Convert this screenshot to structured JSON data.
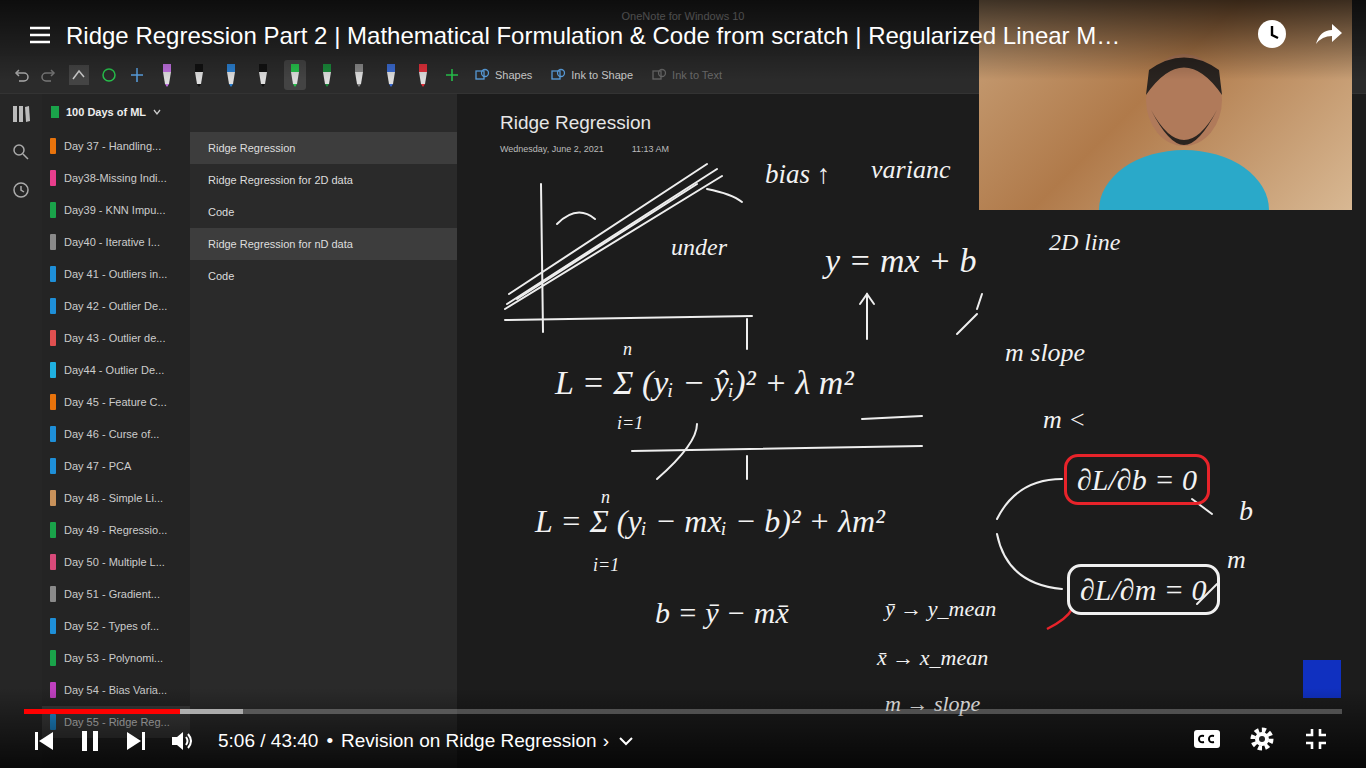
{
  "player": {
    "title": "Ridge Regression Part 2 | Mathematical Formulation & Code from scratch | Regularized Linear M…",
    "time": "5:06 / 43:40",
    "separator": "•",
    "chapter": "Revision on Ridge Regression",
    "chapter_arrow": "›",
    "playing": true,
    "level": 0.118,
    "buffered": 0.166
  },
  "onenote": {
    "app_title": "OneNote for Windows 10",
    "pens": [
      {
        "color": "#c070e0",
        "selected": false
      },
      {
        "color": "#111111",
        "selected": false
      },
      {
        "color": "#2a7fd0",
        "selected": false
      },
      {
        "color": "#111111",
        "selected": false
      },
      {
        "color": "#27c24c",
        "selected": true
      },
      {
        "color": "#1a8a3a",
        "selected": false
      },
      {
        "color": "#888888",
        "selected": false
      },
      {
        "color": "#3a6ad0",
        "selected": false
      },
      {
        "color": "#e0303a",
        "selected": false
      }
    ],
    "toolbar": [
      {
        "label": "Shapes",
        "disabled": false
      },
      {
        "label": "Ink to Shape",
        "disabled": false
      },
      {
        "label": "Ink to Text",
        "disabled": true
      }
    ],
    "notebook": "100 Days of ML",
    "sections": [
      {
        "label": "Day 37 - Handling...",
        "color": "#e8730c",
        "selected": false
      },
      {
        "label": "Day38-Missing Indi...",
        "color": "#e83e8c",
        "selected": false
      },
      {
        "label": "Day39 - KNN Impu...",
        "color": "#1aa34a",
        "selected": false
      },
      {
        "label": "Day40 - Iterative I...",
        "color": "#8a8a8a",
        "selected": false
      },
      {
        "label": "Day 41 - Outliers in...",
        "color": "#1e8fd8",
        "selected": false
      },
      {
        "label": "Day 42 - Outlier De...",
        "color": "#1e8fd8",
        "selected": false
      },
      {
        "label": "Day 43 - Outlier de...",
        "color": "#e05050",
        "selected": false
      },
      {
        "label": "Day44 - Outlier De...",
        "color": "#1fb0e0",
        "selected": false
      },
      {
        "label": "Day 45 - Feature C...",
        "color": "#e8730c",
        "selected": false
      },
      {
        "label": "Day 46 - Curse of...",
        "color": "#1e8fd8",
        "selected": false
      },
      {
        "label": "Day 47 - PCA",
        "color": "#1e8fd8",
        "selected": false
      },
      {
        "label": "Day 48 - Simple Li...",
        "color": "#c8915a",
        "selected": false
      },
      {
        "label": "Day 49 - Regressio...",
        "color": "#1aa34a",
        "selected": false
      },
      {
        "label": "Day 50 - Multiple L...",
        "color": "#d84a7a",
        "selected": false
      },
      {
        "label": "Day 51 - Gradient...",
        "color": "#8a8a8a",
        "selected": false
      },
      {
        "label": "Day 52 - Types of...",
        "color": "#1e8fd8",
        "selected": false
      },
      {
        "label": "Day 53 - Polynomi...",
        "color": "#1aa34a",
        "selected": false
      },
      {
        "label": "Day 54 - Bias Varia...",
        "color": "#c040c0",
        "selected": false
      },
      {
        "label": "Day 55 - Ridge Reg...",
        "color": "#1e8fd8",
        "selected": true
      }
    ],
    "pages": [
      {
        "label": "Ridge Regression",
        "selected": true
      },
      {
        "label": "Ridge Regression for 2D data",
        "selected": false
      },
      {
        "label": "Code",
        "selected": false
      },
      {
        "label": "Ridge Regression for nD data",
        "selected": true
      },
      {
        "label": "Code",
        "selected": false
      }
    ],
    "page": {
      "title": "Ridge Regression",
      "date": "Wednesday, June 2, 2021",
      "time": "11:13 AM",
      "ink": [
        {
          "text": "bias ↑",
          "kind": "plain"
        },
        {
          "text": "varianc",
          "kind": "plain"
        },
        {
          "text": "under",
          "kind": "plain"
        },
        {
          "text": "y = mx + b",
          "kind": "plain"
        },
        {
          "text": "2D line",
          "kind": "plain"
        },
        {
          "text": "m slope",
          "kind": "plain"
        },
        {
          "text": "m <",
          "kind": "plain"
        },
        {
          "text": "L = Σ (yᵢ − ŷᵢ)² + λ m²",
          "kind": "plain"
        },
        {
          "text": "n",
          "kind": "plain"
        },
        {
          "text": "i=1",
          "kind": "plain"
        },
        {
          "text": "L = Σ (yᵢ − mxᵢ − b)² + λm²",
          "kind": "plain"
        },
        {
          "text": "n",
          "kind": "plain"
        },
        {
          "text": "i=1",
          "kind": "plain"
        },
        {
          "text": "∂L/∂b = 0",
          "kind": "red-box"
        },
        {
          "text": "b",
          "kind": "plain"
        },
        {
          "text": "∂L/∂m = 0",
          "kind": "box"
        },
        {
          "text": "m",
          "kind": "plain"
        },
        {
          "text": "b = ȳ − mx̄",
          "kind": "plain"
        },
        {
          "text": "ȳ → y_mean",
          "kind": "plain"
        },
        {
          "text": "x̄ → x_mean",
          "kind": "plain"
        },
        {
          "text": "m → slope",
          "kind": "plain"
        }
      ]
    }
  }
}
